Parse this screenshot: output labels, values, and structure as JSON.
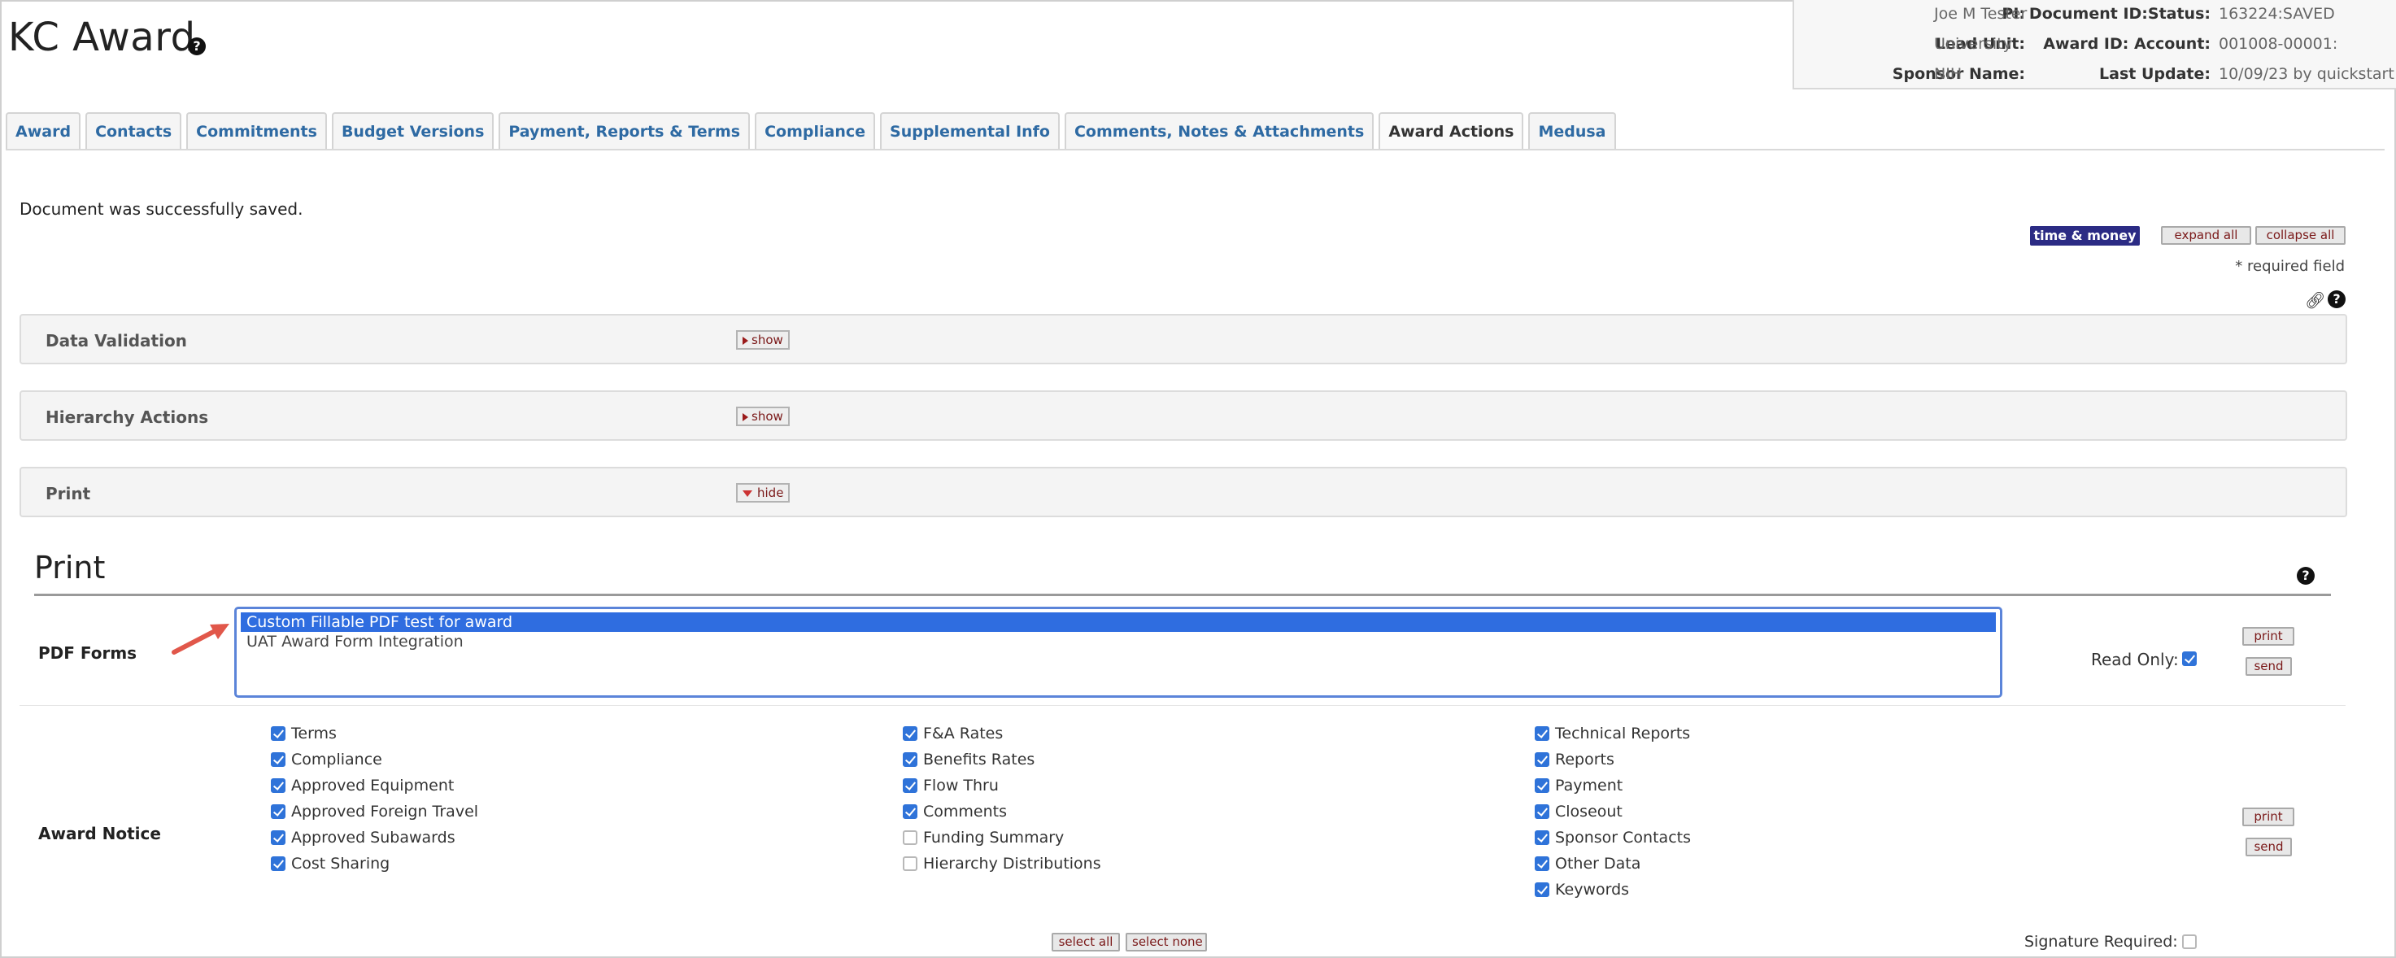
{
  "header": {
    "title": "KC Award",
    "help_icon": "question-circle-icon"
  },
  "doc_info": {
    "pi_label": "PI:",
    "pi_value": "Joe M Tester",
    "docid_label": "Document ID:Status:",
    "docid_value": "163224:SAVED",
    "leadunit_label": "Lead Unit:",
    "leadunit_value": "University",
    "awardid_label": "Award ID: Account:",
    "awardid_value": "001008-00001:",
    "sponsor_label": "Sponsor Name:",
    "sponsor_value": "NIH",
    "lastupdate_label": "Last Update:",
    "lastupdate_value": "10/09/23 by quickstart"
  },
  "tabs": [
    {
      "label": "Award"
    },
    {
      "label": "Contacts"
    },
    {
      "label": "Commitments"
    },
    {
      "label": "Budget Versions"
    },
    {
      "label": "Payment, Reports & Terms"
    },
    {
      "label": "Compliance"
    },
    {
      "label": "Supplemental Info"
    },
    {
      "label": "Comments, Notes & Attachments"
    },
    {
      "label": "Award Actions"
    },
    {
      "label": "Medusa"
    }
  ],
  "messages": {
    "saved": "Document was successfully saved."
  },
  "toolbar": {
    "time_money": "time & money",
    "expand_all": "expand all",
    "collapse_all": "collapse all",
    "required_field": "* required field"
  },
  "sections": {
    "data_validation": {
      "title": "Data Validation",
      "toggle": "show"
    },
    "hierarchy_actions": {
      "title": "Hierarchy Actions",
      "toggle": "show"
    },
    "print": {
      "title": "Print",
      "toggle": "hide"
    }
  },
  "print_panel": {
    "heading": "Print",
    "pdf_forms_label": "PDF Forms",
    "pdf_forms": [
      {
        "label": "Custom Fillable PDF test for award",
        "selected": true
      },
      {
        "label": "UAT Award Form Integration",
        "selected": false
      }
    ],
    "read_only_label": "Read Only:",
    "print_btn": "print",
    "send_btn": "send",
    "award_notice_label": "Award Notice",
    "award_notice_col1": [
      {
        "label": "Terms",
        "checked": true
      },
      {
        "label": "Compliance",
        "checked": true
      },
      {
        "label": "Approved Equipment",
        "checked": true
      },
      {
        "label": "Approved Foreign Travel",
        "checked": true
      },
      {
        "label": "Approved Subawards",
        "checked": true
      },
      {
        "label": "Cost Sharing",
        "checked": true
      }
    ],
    "award_notice_col2": [
      {
        "label": "F&A Rates",
        "checked": true
      },
      {
        "label": "Benefits Rates",
        "checked": true
      },
      {
        "label": "Flow Thru",
        "checked": true
      },
      {
        "label": "Comments",
        "checked": true
      },
      {
        "label": "Funding Summary",
        "checked": false
      },
      {
        "label": "Hierarchy Distributions",
        "checked": false
      }
    ],
    "award_notice_col3": [
      {
        "label": "Technical Reports",
        "checked": true
      },
      {
        "label": "Reports",
        "checked": true
      },
      {
        "label": "Payment",
        "checked": true
      },
      {
        "label": "Closeout",
        "checked": true
      },
      {
        "label": "Sponsor Contacts",
        "checked": true
      },
      {
        "label": "Other Data",
        "checked": true
      },
      {
        "label": "Keywords",
        "checked": true
      }
    ],
    "select_all": "select all",
    "select_none": "select none",
    "signature_required_label": "Signature Required:"
  }
}
